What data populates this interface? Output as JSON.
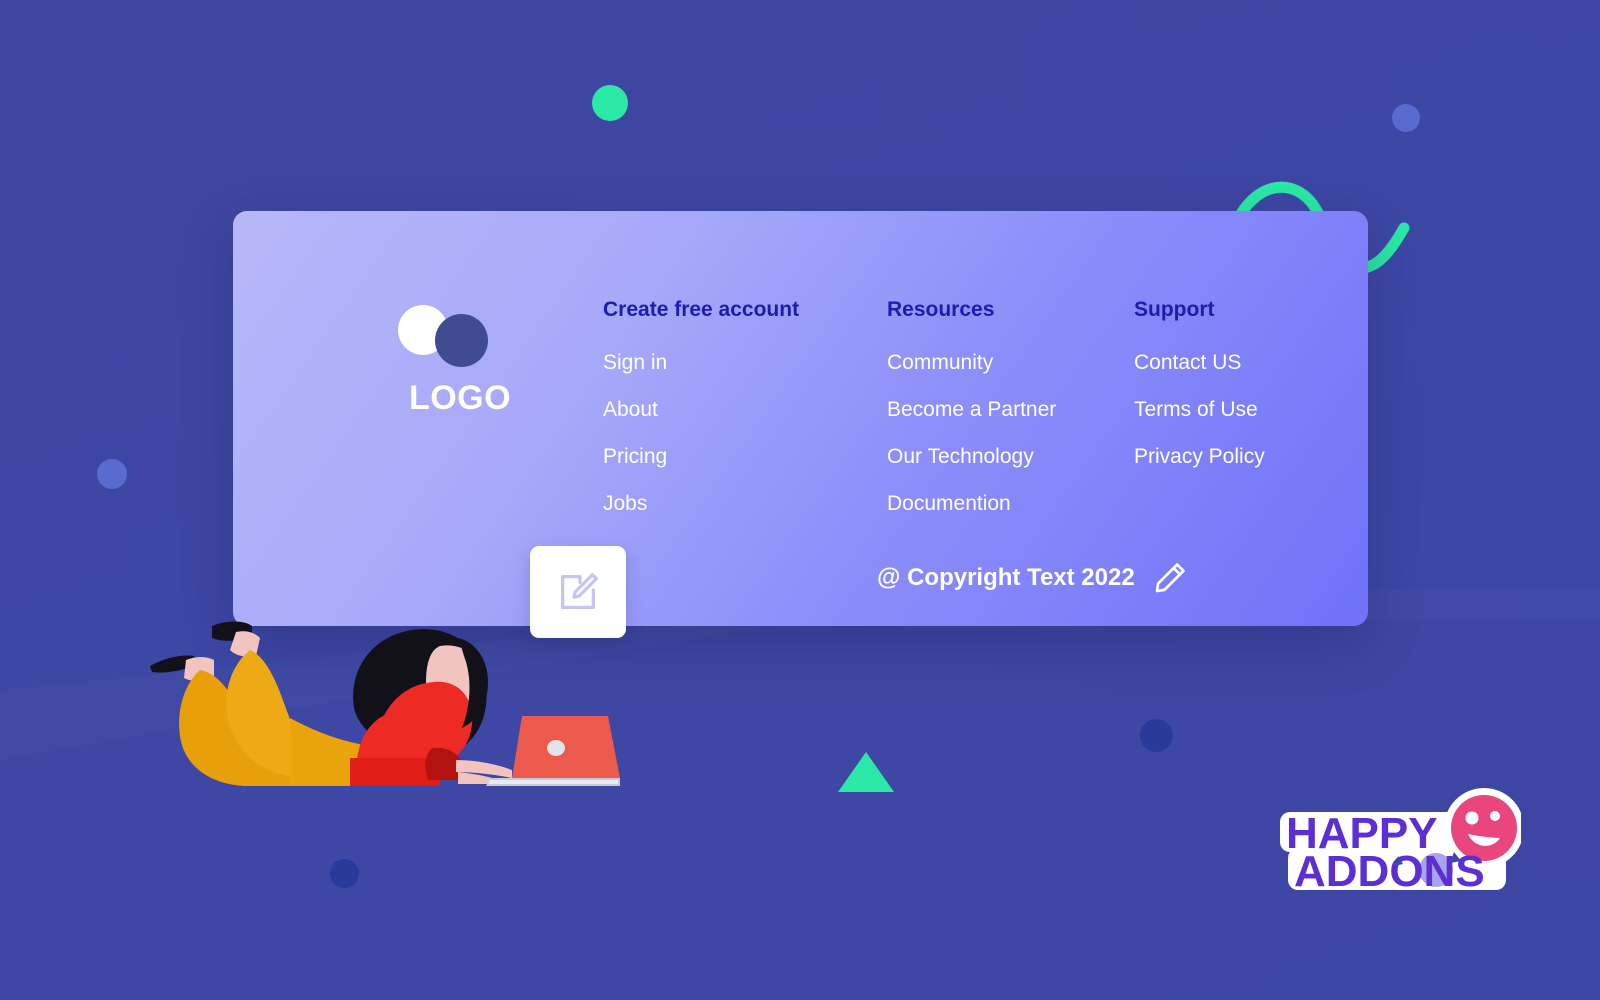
{
  "brand": {
    "logo_text": "LOGO",
    "logo_circle_light": "#ffffff",
    "logo_circle_dark": "#3f4b93"
  },
  "footer": {
    "columns": [
      {
        "title": "Create free account",
        "links": [
          "Sign in",
          "About",
          "Pricing",
          "Jobs"
        ]
      },
      {
        "title": "Resources",
        "links": [
          "Community",
          "Become a Partner",
          "Our Technology",
          "Documention"
        ]
      },
      {
        "title": "Support",
        "links": [
          "Contact US",
          "Terms of Use",
          "Privacy Policy"
        ]
      }
    ],
    "copyright": "@ Copyright Text 2022",
    "copyright_edit_icon": "pencil-icon"
  },
  "editor": {
    "edit_button_icon": "edit-square-pencil-icon"
  },
  "watermark": {
    "line1": "HAPPY",
    "line2": "ADDONS",
    "face_icon": "smiley-face-icon"
  },
  "colors": {
    "background": "#3e46a0",
    "card_gradient_start": "#b7b7f8",
    "card_gradient_end": "#6f72f8",
    "heading": "#1c1caf",
    "link": "#ffffff",
    "accent_green": "#2ce8a6",
    "dot_light": "#5a6bd0",
    "dot_dark": "#2a3a9a",
    "watermark_purple": "#5b2fd4",
    "watermark_pink": "#e8467c"
  },
  "decor": {
    "wave_icon": "sine-wave-shape",
    "triangle_icon": "triangle-shape",
    "dots": [
      "green-dot",
      "light-dot-top-right",
      "light-dot-left",
      "dark-dot-right",
      "dark-dot-bottom"
    ]
  },
  "illustration": {
    "name": "woman-lying-with-laptop-illustration",
    "hair": "#12111a",
    "shirt": "#ee2a24",
    "pants": "#e8a00a",
    "skin": "#f2c4c0",
    "laptop": "#ec5a4e"
  }
}
